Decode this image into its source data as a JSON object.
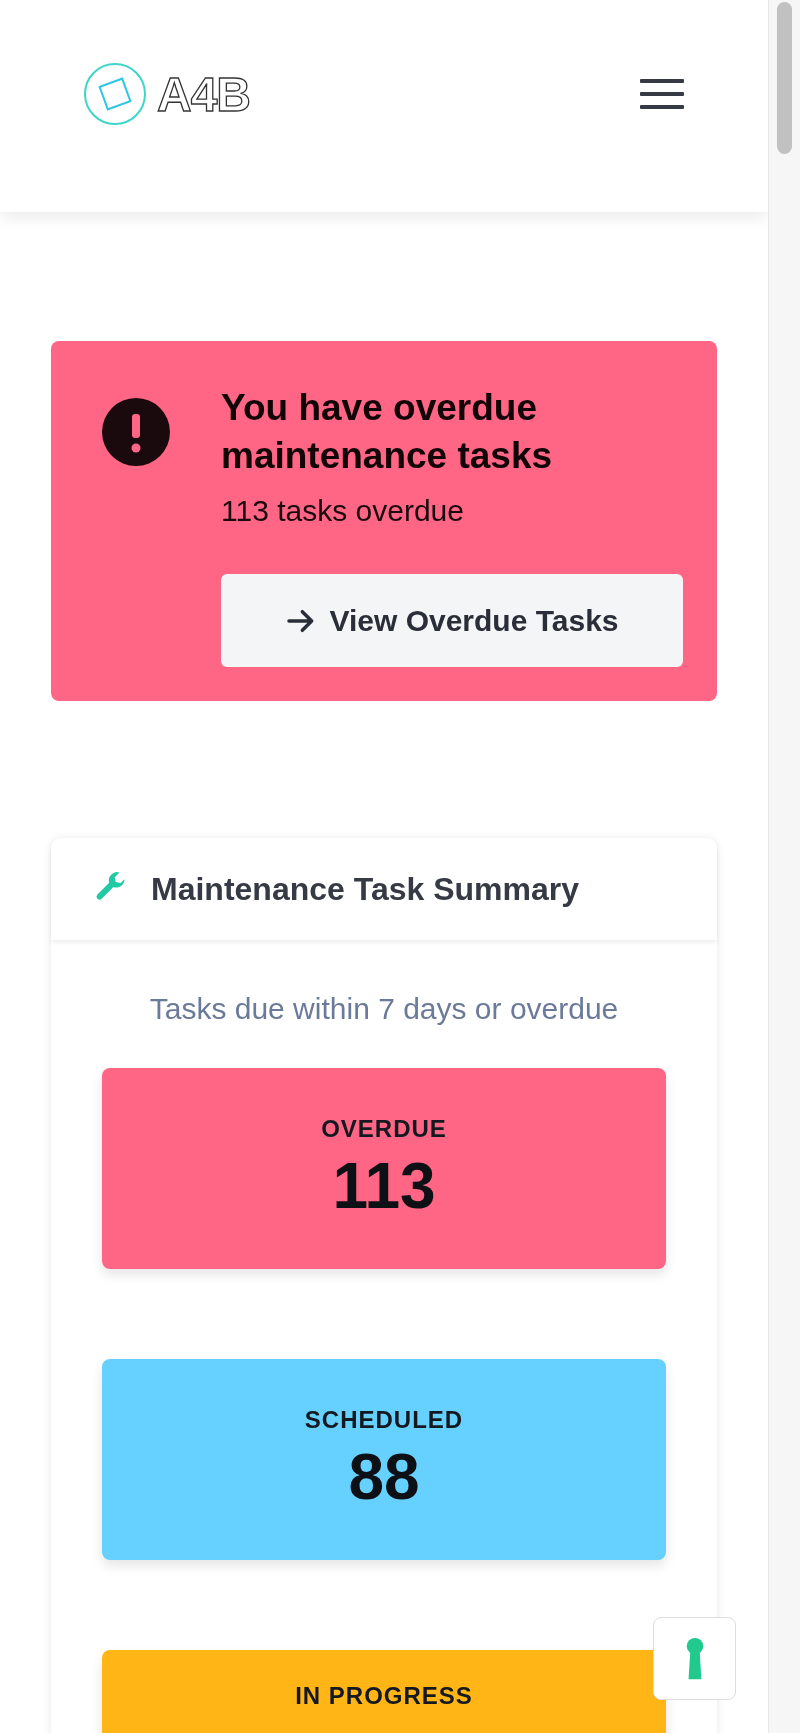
{
  "header": {
    "logo_text": "A4B"
  },
  "alert": {
    "title": "You have overdue maintenance tasks",
    "subtitle": "113 tasks overdue",
    "button": "View Overdue Tasks"
  },
  "summary": {
    "title": "Maintenance Task Summary",
    "subtitle": "Tasks due within 7 days or overdue",
    "stats": [
      {
        "label": "OVERDUE",
        "value": "113",
        "color": "#ff6685"
      },
      {
        "label": "SCHEDULED",
        "value": "88",
        "color": "#66d1ff"
      },
      {
        "label": "IN PROGRESS",
        "color": "#ffb515"
      }
    ]
  }
}
